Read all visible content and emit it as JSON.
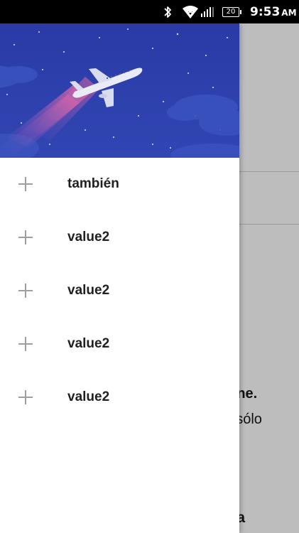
{
  "status_bar": {
    "battery": "20",
    "time": "9:53",
    "ampm": "AM",
    "icons": [
      "bluetooth-icon",
      "wifi-icon",
      "signal-icon",
      "battery-icon"
    ]
  },
  "background": {
    "text_line1": "nline.",
    "text_line2": "o, sólo",
    "text_line3": "alla"
  },
  "drawer": {
    "header_image": "airplane-night-sky-illustration",
    "colors": {
      "header_bg": "#2f3fa9",
      "text": "#212121",
      "icon": "#9e9e9e"
    },
    "items": [
      {
        "label": "también",
        "icon": "plus-icon"
      },
      {
        "label": "value2",
        "icon": "plus-icon"
      },
      {
        "label": "value2",
        "icon": "plus-icon"
      },
      {
        "label": "value2",
        "icon": "plus-icon"
      },
      {
        "label": "value2",
        "icon": "plus-icon"
      }
    ]
  }
}
